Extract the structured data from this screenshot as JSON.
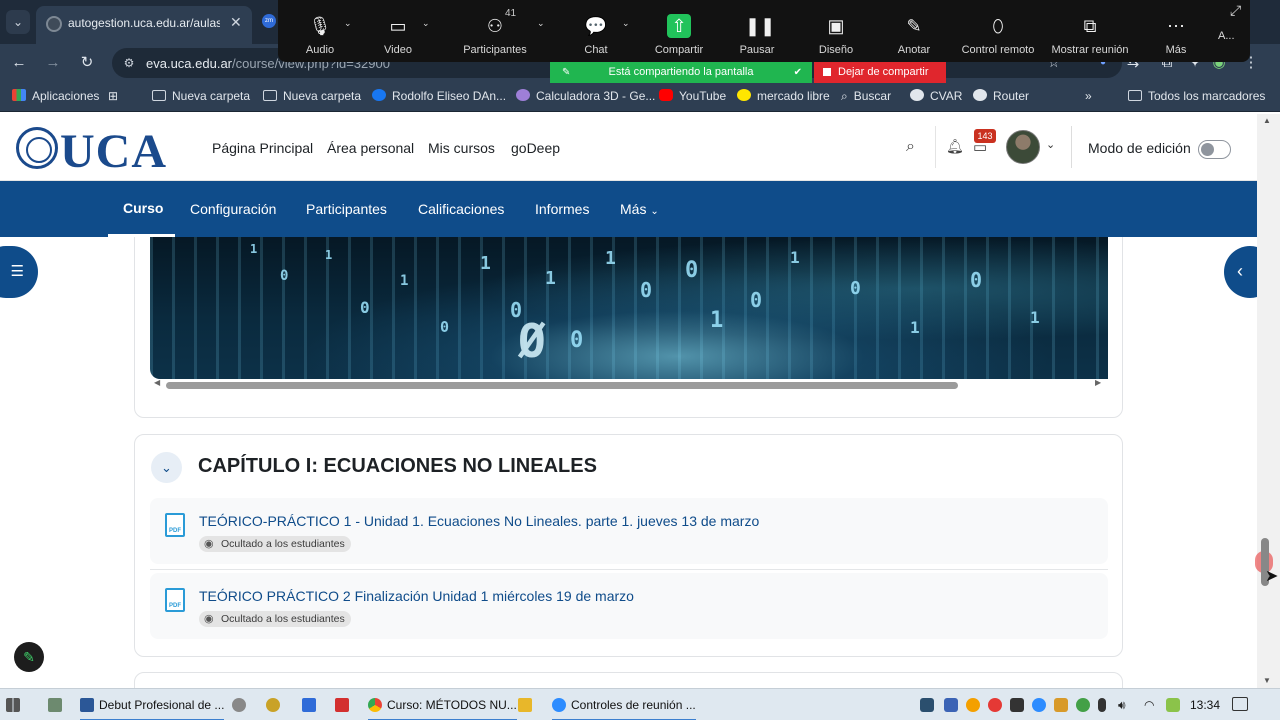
{
  "browser": {
    "tab_title": "autogestion.uca.edu.ar/aulas-z",
    "url_host": "eva.uca.edu.ar",
    "url_path": "/course/view.php?id=32900",
    "bookmarks": [
      {
        "label": "Aplicaciones",
        "icon": "apps-grid-icon"
      },
      {
        "label": "Nueva carpeta",
        "icon": "folder-icon"
      },
      {
        "label": "Nueva carpeta",
        "icon": "folder-icon"
      },
      {
        "label": "Rodolfo Eliseo DAn...",
        "icon": "facebook-icon"
      },
      {
        "label": "Calculadora 3D - Ge...",
        "icon": "geogebra-icon"
      },
      {
        "label": "YouTube",
        "icon": "youtube-icon"
      },
      {
        "label": "mercado libre",
        "icon": "mercadolibre-icon"
      },
      {
        "label": "Buscar",
        "icon": "search-icon"
      },
      {
        "label": "CVAR",
        "icon": "globe-icon"
      },
      {
        "label": "Router",
        "icon": "globe-icon"
      }
    ],
    "all_bookmarks": "Todos los marcadores"
  },
  "zoom": {
    "controls": [
      {
        "label": "Audio",
        "icon": "microphone-icon"
      },
      {
        "label": "Video",
        "icon": "camera-icon"
      },
      {
        "label": "Participantes",
        "icon": "participants-icon"
      },
      {
        "label": "Chat",
        "icon": "chat-icon"
      },
      {
        "label": "Compartir",
        "icon": "share-icon"
      },
      {
        "label": "Pausar",
        "icon": "pause-icon"
      },
      {
        "label": "Diseño",
        "icon": "layout-icon"
      },
      {
        "label": "Anotar",
        "icon": "pencil-icon"
      },
      {
        "label": "Control remoto",
        "icon": "mouse-icon"
      },
      {
        "label": "Mostrar reunión",
        "icon": "show-meeting-icon"
      },
      {
        "label": "Más",
        "icon": "more-icon"
      }
    ],
    "participants_count": "41",
    "sharing_banner": "Está compartiendo la pantalla",
    "stop_share": "Dejar de compartir",
    "overflow_text": "A..."
  },
  "moodle": {
    "logo_text": "UCA",
    "topnav": [
      "Página Principal",
      "Área personal",
      "Mis cursos",
      "goDeep"
    ],
    "notification_count": "143",
    "edit_mode_label": "Modo de edición",
    "secondary_nav": [
      "Curso",
      "Configuración",
      "Participantes",
      "Calificaciones",
      "Informes",
      "Más"
    ],
    "banner_bits": [
      "1",
      "0",
      "1",
      "0",
      "1",
      "0",
      "1",
      "0",
      "1",
      "0",
      "1",
      "0",
      "0",
      "1",
      "0",
      "1",
      "0",
      "1",
      "0",
      "1",
      "Ø"
    ],
    "section": {
      "title": "CAPÍTULO I: ECUACIONES NO LINEALES",
      "activities": [
        {
          "title": "TEÓRICO-PRÁCTICO 1 - Unidad 1. Ecuaciones No Lineales. parte 1. jueves 13 de marzo",
          "badge": "Ocultado a los estudiantes",
          "icon": "pdf-icon"
        },
        {
          "title": "TEÓRICO PRÁCTICO 2 Finalización Unidad 1 miércoles 19 de marzo",
          "badge": "Ocultado a los estudiantes",
          "icon": "pdf-icon"
        }
      ]
    }
  },
  "taskbar": {
    "apps": [
      "Debut Profesional de ...",
      "Curso: MÉTODOS NU...",
      "Controles de reunión ..."
    ],
    "clock": "13:34"
  },
  "colors": {
    "brand_blue": "#0f4c8a",
    "link_blue": "#0f4c8a",
    "share_green": "#21c35b",
    "stop_red": "#e0262d",
    "badge_red": "#ca3120"
  }
}
